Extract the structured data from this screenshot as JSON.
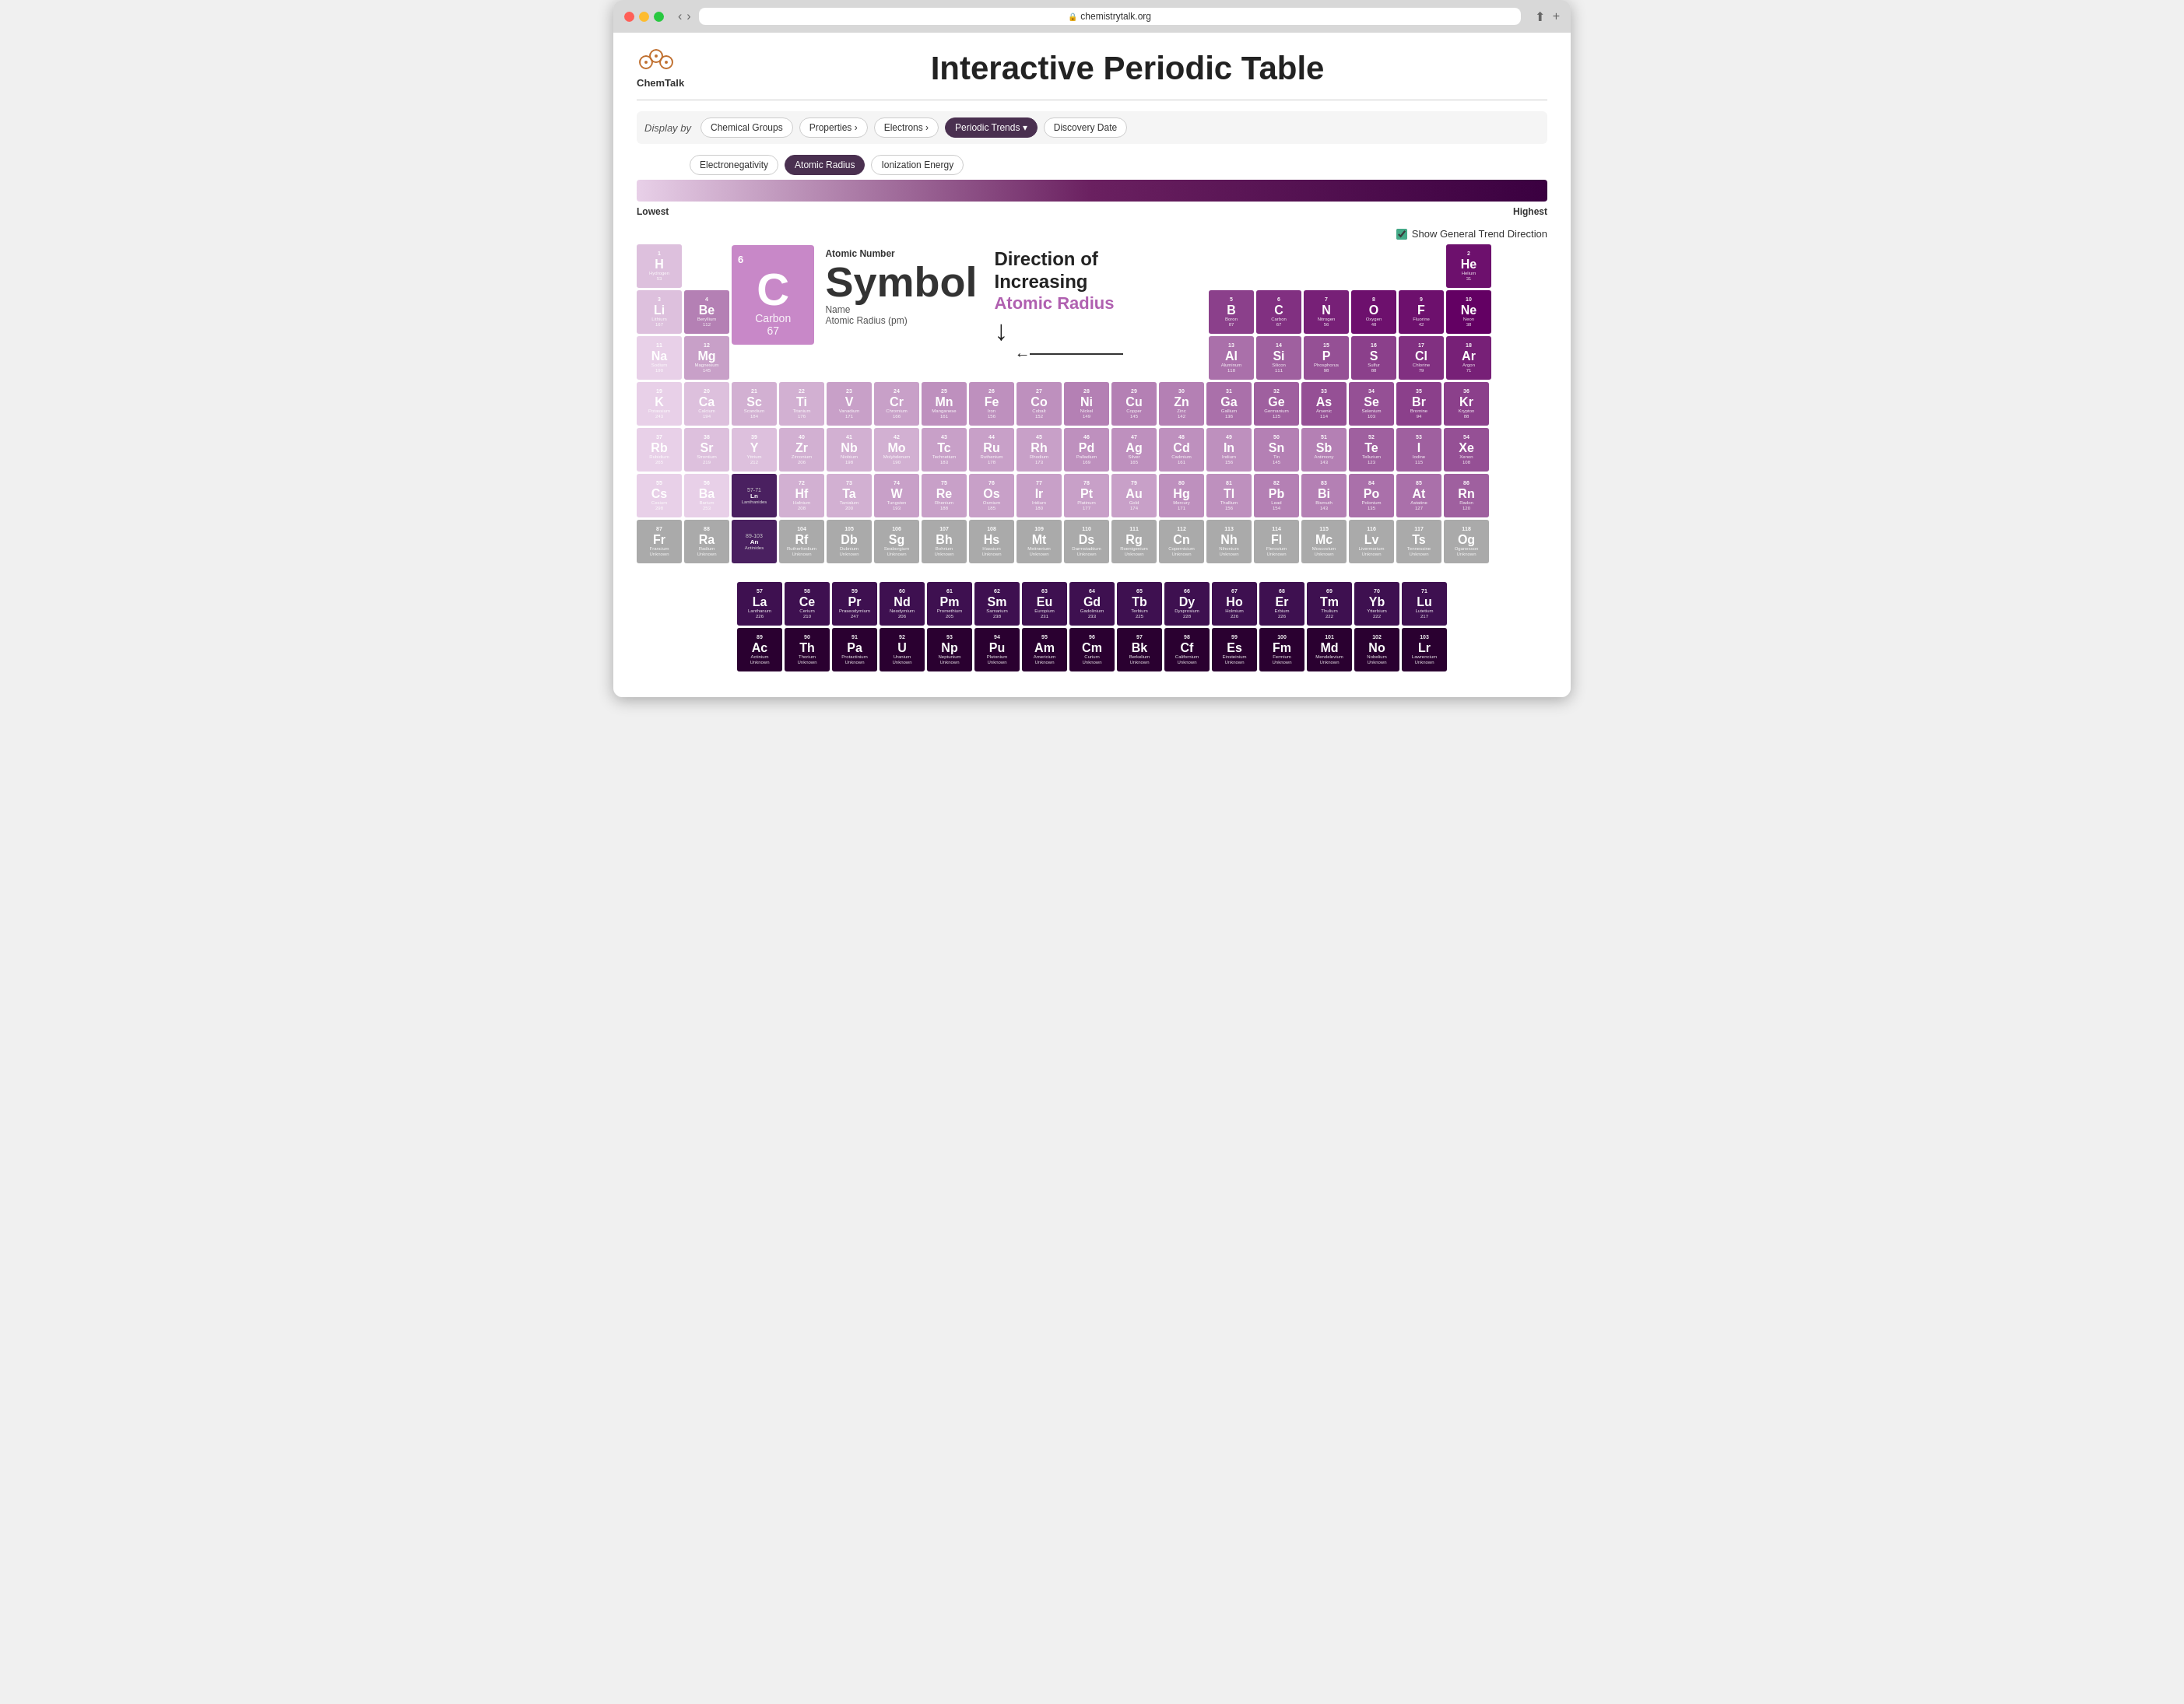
{
  "browser": {
    "url": "chemistrytalk.org"
  },
  "header": {
    "logo": "ChemTalk",
    "title": "Interactive Periodic Table"
  },
  "toolbar": {
    "display_label": "Display by",
    "buttons": [
      {
        "id": "chemical-groups",
        "label": "Chemical Groups",
        "active": false
      },
      {
        "id": "properties",
        "label": "Properties",
        "arrow": true,
        "active": false
      },
      {
        "id": "electrons",
        "label": "Electrons",
        "arrow": true,
        "active": false
      },
      {
        "id": "periodic-trends",
        "label": "Periodic Trends",
        "arrow": true,
        "active": true
      },
      {
        "id": "discovery-date",
        "label": "Discovery Date",
        "active": false
      }
    ],
    "sub_buttons": [
      {
        "id": "electronegativity",
        "label": "Electronegativity",
        "active": false
      },
      {
        "id": "atomic-radius",
        "label": "Atomic Radius",
        "active": true
      },
      {
        "id": "ionization-energy",
        "label": "Ionization Energy",
        "active": false
      }
    ]
  },
  "gradient": {
    "lowest": "Lowest",
    "highest": "Highest"
  },
  "show_trend": {
    "label": "Show General Trend Direction",
    "checked": true
  },
  "featured_element": {
    "number": "6",
    "symbol": "C",
    "name": "Carbon",
    "mass": "67",
    "info_label_atomic_number": "Atomic Number",
    "info_symbol": "Symbol",
    "info_label_name": "Name",
    "info_label_mass": "Atomic Radius (pm)"
  },
  "direction": {
    "title": "Direction of Increasing",
    "subtitle": "Atomic Radius"
  },
  "elements": {
    "row1": [
      {
        "num": "1",
        "sym": "H",
        "name": "Hydrogen",
        "mass": "53",
        "col": "c1"
      },
      {
        "num": "2",
        "sym": "He",
        "name": "Helium",
        "mass": "31",
        "col": "cc"
      }
    ],
    "row2": [
      {
        "num": "3",
        "sym": "Li",
        "name": "Lithium",
        "mass": "167",
        "col": "c1"
      },
      {
        "num": "4",
        "sym": "Be",
        "name": "Beryllium",
        "mass": "112",
        "col": "c5"
      },
      {
        "num": "5",
        "sym": "B",
        "name": "Boron",
        "mass": "87",
        "col": "c9"
      },
      {
        "num": "6",
        "sym": "C",
        "name": "Carbon",
        "mass": "67",
        "col": "ca"
      },
      {
        "num": "7",
        "sym": "N",
        "name": "Nitrogen",
        "mass": "56",
        "col": "cb"
      },
      {
        "num": "8",
        "sym": "O",
        "name": "Oxygen",
        "mass": "48",
        "col": "cc"
      },
      {
        "num": "9",
        "sym": "F",
        "name": "Fluorine",
        "mass": "42",
        "col": "cc"
      },
      {
        "num": "10",
        "sym": "Ne",
        "name": "Neon",
        "mass": "38",
        "col": "cd"
      }
    ],
    "row3": [
      {
        "num": "11",
        "sym": "Na",
        "name": "Sodium",
        "mass": "190",
        "col": "c0"
      },
      {
        "num": "12",
        "sym": "Mg",
        "name": "Magnesium",
        "mass": "145",
        "col": "c3"
      },
      {
        "num": "13",
        "sym": "Al",
        "name": "Aluminum",
        "mass": "118",
        "col": "c6"
      },
      {
        "num": "14",
        "sym": "Si",
        "name": "Silicon",
        "mass": "111",
        "col": "c7"
      },
      {
        "num": "15",
        "sym": "P",
        "name": "Phosphorus",
        "mass": "98",
        "col": "c8"
      },
      {
        "num": "16",
        "sym": "S",
        "name": "Sulfur",
        "mass": "88",
        "col": "c9"
      },
      {
        "num": "17",
        "sym": "Cl",
        "name": "Chlorine",
        "mass": "79",
        "col": "ca"
      },
      {
        "num": "18",
        "sym": "Ar",
        "name": "Argon",
        "mass": "71",
        "col": "cb"
      }
    ],
    "row4": [
      {
        "num": "19",
        "sym": "K",
        "name": "Potassium",
        "mass": "243",
        "col": "c0"
      },
      {
        "num": "20",
        "sym": "Ca",
        "name": "Calcium",
        "mass": "194",
        "col": "c1"
      },
      {
        "num": "21",
        "sym": "Sc",
        "name": "Scandium",
        "mass": "184",
        "col": "c2"
      },
      {
        "num": "22",
        "sym": "Ti",
        "name": "Titanium",
        "mass": "176",
        "col": "c2"
      },
      {
        "num": "23",
        "sym": "V",
        "name": "Vanadium",
        "mass": "171",
        "col": "c3"
      },
      {
        "num": "24",
        "sym": "Cr",
        "name": "Chromium",
        "mass": "166",
        "col": "c3"
      },
      {
        "num": "25",
        "sym": "Mn",
        "name": "Manganese",
        "mass": "161",
        "col": "c4"
      },
      {
        "num": "26",
        "sym": "Fe",
        "name": "Iron",
        "mass": "156",
        "col": "c4"
      },
      {
        "num": "27",
        "sym": "Co",
        "name": "Cobalt",
        "mass": "152",
        "col": "c4"
      },
      {
        "num": "28",
        "sym": "Ni",
        "name": "Nickel",
        "mass": "149",
        "col": "c5"
      },
      {
        "num": "29",
        "sym": "Cu",
        "name": "Copper",
        "mass": "145",
        "col": "c5"
      },
      {
        "num": "30",
        "sym": "Zn",
        "name": "Zinc",
        "mass": "142",
        "col": "c5"
      },
      {
        "num": "31",
        "sym": "Ga",
        "name": "Gallium",
        "mass": "136",
        "col": "c6"
      },
      {
        "num": "32",
        "sym": "Ge",
        "name": "Germanium",
        "mass": "125",
        "col": "c7"
      },
      {
        "num": "33",
        "sym": "As",
        "name": "Arsenic",
        "mass": "114",
        "col": "c8"
      },
      {
        "num": "34",
        "sym": "Se",
        "name": "Selenium",
        "mass": "103",
        "col": "c8"
      },
      {
        "num": "35",
        "sym": "Br",
        "name": "Bromine",
        "mass": "94",
        "col": "c9"
      },
      {
        "num": "36",
        "sym": "Kr",
        "name": "Krypton",
        "mass": "88",
        "col": "c9"
      }
    ],
    "row5": [
      {
        "num": "37",
        "sym": "Rb",
        "name": "Rubidium",
        "mass": "265",
        "col": "c0"
      },
      {
        "num": "38",
        "sym": "Sr",
        "name": "Strontium",
        "mass": "219",
        "col": "c1"
      },
      {
        "num": "39",
        "sym": "Y",
        "name": "Yttrium",
        "mass": "212",
        "col": "c1"
      },
      {
        "num": "40",
        "sym": "Zr",
        "name": "Zirconium",
        "mass": "206",
        "col": "c2"
      },
      {
        "num": "41",
        "sym": "Nb",
        "name": "Niobium",
        "mass": "198",
        "col": "c2"
      },
      {
        "num": "42",
        "sym": "Mo",
        "name": "Molybdenum",
        "mass": "190",
        "col": "c2"
      },
      {
        "num": "43",
        "sym": "Tc",
        "name": "Technetium",
        "mass": "183",
        "col": "c3"
      },
      {
        "num": "44",
        "sym": "Ru",
        "name": "Ruthenium",
        "mass": "178",
        "col": "c3"
      },
      {
        "num": "45",
        "sym": "Rh",
        "name": "Rhodium",
        "mass": "173",
        "col": "c3"
      },
      {
        "num": "46",
        "sym": "Pd",
        "name": "Palladium",
        "mass": "169",
        "col": "c4"
      },
      {
        "num": "47",
        "sym": "Ag",
        "name": "Silver",
        "mass": "165",
        "col": "c4"
      },
      {
        "num": "48",
        "sym": "Cd",
        "name": "Cadmium",
        "mass": "161",
        "col": "c4"
      },
      {
        "num": "49",
        "sym": "In",
        "name": "Indium",
        "mass": "156",
        "col": "c4"
      },
      {
        "num": "50",
        "sym": "Sn",
        "name": "Tin",
        "mass": "145",
        "col": "c5"
      },
      {
        "num": "51",
        "sym": "Sb",
        "name": "Antimony",
        "mass": "143",
        "col": "c5"
      },
      {
        "num": "52",
        "sym": "Te",
        "name": "Tellurium",
        "mass": "123",
        "col": "c7"
      },
      {
        "num": "53",
        "sym": "I",
        "name": "Iodine",
        "mass": "115",
        "col": "c7"
      },
      {
        "num": "54",
        "sym": "Xe",
        "name": "Xenon",
        "mass": "108",
        "col": "c8"
      }
    ],
    "row6": [
      {
        "num": "55",
        "sym": "Cs",
        "name": "Cesium",
        "mass": "298",
        "col": "c0"
      },
      {
        "num": "56",
        "sym": "Ba",
        "name": "Barium",
        "mass": "253",
        "col": "c0"
      },
      {
        "num": "57-71",
        "sym": "",
        "name": "Lanthanides",
        "mass": "57-71",
        "col": "cl",
        "span": true
      },
      {
        "num": "72",
        "sym": "Hf",
        "name": "Hafnium",
        "mass": "208",
        "col": "c2"
      },
      {
        "num": "73",
        "sym": "Ta",
        "name": "Tantalum",
        "mass": "200",
        "col": "c2"
      },
      {
        "num": "74",
        "sym": "W",
        "name": "Tungsten",
        "mass": "193",
        "col": "c3"
      },
      {
        "num": "75",
        "sym": "Re",
        "name": "Rhenium",
        "mass": "188",
        "col": "c3"
      },
      {
        "num": "76",
        "sym": "Os",
        "name": "Osmium",
        "mass": "185",
        "col": "c3"
      },
      {
        "num": "77",
        "sym": "Ir",
        "name": "Iridium",
        "mass": "180",
        "col": "c3"
      },
      {
        "num": "78",
        "sym": "Pt",
        "name": "Platinum",
        "mass": "177",
        "col": "c3"
      },
      {
        "num": "79",
        "sym": "Au",
        "name": "Gold",
        "mass": "174",
        "col": "c3"
      },
      {
        "num": "80",
        "sym": "Hg",
        "name": "Mercury",
        "mass": "171",
        "col": "c4"
      },
      {
        "num": "81",
        "sym": "Tl",
        "name": "Thallium",
        "mass": "156",
        "col": "c4"
      },
      {
        "num": "82",
        "sym": "Pb",
        "name": "Lead",
        "mass": "154",
        "col": "c5"
      },
      {
        "num": "83",
        "sym": "Bi",
        "name": "Bismuth",
        "mass": "143",
        "col": "c5"
      },
      {
        "num": "84",
        "sym": "Po",
        "name": "Polonium",
        "mass": "135",
        "col": "c6"
      },
      {
        "num": "85",
        "sym": "At",
        "name": "Astatine",
        "mass": "127",
        "col": "c6"
      },
      {
        "num": "86",
        "sym": "Rn",
        "name": "Radon",
        "mass": "120",
        "col": "c7"
      }
    ],
    "row7": [
      {
        "num": "87",
        "sym": "Fr",
        "name": "Francium",
        "mass": "Unknown",
        "col": "cg"
      },
      {
        "num": "88",
        "sym": "Ra",
        "name": "Radium",
        "mass": "Unknown",
        "col": "cg"
      },
      {
        "num": "89-103",
        "sym": "",
        "name": "Actinides",
        "mass": "89-103",
        "col": "cl",
        "span": true
      },
      {
        "num": "104",
        "sym": "Rf",
        "name": "Rutherfordium",
        "mass": "Unknown",
        "col": "cg"
      },
      {
        "num": "105",
        "sym": "Db",
        "name": "Dubnium",
        "mass": "Unknown",
        "col": "cg"
      },
      {
        "num": "106",
        "sym": "Sg",
        "name": "Seaborgium",
        "mass": "Unknown",
        "col": "cg"
      },
      {
        "num": "107",
        "sym": "Bh",
        "name": "Bohrium",
        "mass": "Unknown",
        "col": "cg"
      },
      {
        "num": "108",
        "sym": "Hs",
        "name": "Hassium",
        "mass": "Unknown",
        "col": "cg"
      },
      {
        "num": "109",
        "sym": "Mt",
        "name": "Meitnerium",
        "mass": "Unknown",
        "col": "cg"
      },
      {
        "num": "110",
        "sym": "Ds",
        "name": "Darmstadtium",
        "mass": "Unknown",
        "col": "cg"
      },
      {
        "num": "111",
        "sym": "Rg",
        "name": "Roentgenium",
        "mass": "Unknown",
        "col": "cg"
      },
      {
        "num": "112",
        "sym": "Cn",
        "name": "Copernicium",
        "mass": "Unknown",
        "col": "cg"
      },
      {
        "num": "113",
        "sym": "Nh",
        "name": "Nihonium",
        "mass": "Unknown",
        "col": "cg"
      },
      {
        "num": "114",
        "sym": "Fl",
        "name": "Flerovium",
        "mass": "Unknown",
        "col": "cg"
      },
      {
        "num": "115",
        "sym": "Mc",
        "name": "Moscovium",
        "mass": "Unknown",
        "col": "cg"
      },
      {
        "num": "116",
        "sym": "Lv",
        "name": "Livermorium",
        "mass": "Unknown",
        "col": "cg"
      },
      {
        "num": "117",
        "sym": "Ts",
        "name": "Tennessine",
        "mass": "Unknown",
        "col": "cg"
      },
      {
        "num": "118",
        "sym": "Og",
        "name": "Oganesson",
        "mass": "Unknown",
        "col": "cg"
      }
    ],
    "lanthanides": [
      {
        "num": "57",
        "sym": "La",
        "name": "Lanthanum",
        "mass": "226",
        "col": "cl"
      },
      {
        "num": "58",
        "sym": "Ce",
        "name": "Cerium",
        "mass": "210",
        "col": "cl"
      },
      {
        "num": "59",
        "sym": "Pr",
        "name": "Praseodymium",
        "mass": "247",
        "col": "cl"
      },
      {
        "num": "60",
        "sym": "Nd",
        "name": "Neodymium",
        "mass": "206",
        "col": "cl"
      },
      {
        "num": "61",
        "sym": "Pm",
        "name": "Promethium",
        "mass": "205",
        "col": "cl"
      },
      {
        "num": "62",
        "sym": "Sm",
        "name": "Samarium",
        "mass": "238",
        "col": "cl"
      },
      {
        "num": "63",
        "sym": "Eu",
        "name": "Europium",
        "mass": "231",
        "col": "cl"
      },
      {
        "num": "64",
        "sym": "Gd",
        "name": "Gadolinium",
        "mass": "233",
        "col": "cl"
      },
      {
        "num": "65",
        "sym": "Tb",
        "name": "Terbium",
        "mass": "225",
        "col": "cl"
      },
      {
        "num": "66",
        "sym": "Dy",
        "name": "Dysprosium",
        "mass": "228",
        "col": "cl"
      },
      {
        "num": "67",
        "sym": "Ho",
        "name": "Holmium",
        "mass": "226",
        "col": "cl"
      },
      {
        "num": "68",
        "sym": "Er",
        "name": "Erbium",
        "mass": "226",
        "col": "cl"
      },
      {
        "num": "69",
        "sym": "Tm",
        "name": "Thulium",
        "mass": "222",
        "col": "cl"
      },
      {
        "num": "70",
        "sym": "Yb",
        "name": "Ytterbium",
        "mass": "222",
        "col": "cl"
      },
      {
        "num": "71",
        "sym": "Lu",
        "name": "Lutetium",
        "mass": "217",
        "col": "cl"
      }
    ],
    "actinides": [
      {
        "num": "89",
        "sym": "Ac",
        "name": "Actinium",
        "mass": "Unknown",
        "col": "ac"
      },
      {
        "num": "90",
        "sym": "Th",
        "name": "Thorium",
        "mass": "Unknown",
        "col": "ac"
      },
      {
        "num": "91",
        "sym": "Pa",
        "name": "Protactinium",
        "mass": "Unknown",
        "col": "ac"
      },
      {
        "num": "92",
        "sym": "U",
        "name": "Uranium",
        "mass": "Unknown",
        "col": "ac"
      },
      {
        "num": "93",
        "sym": "Np",
        "name": "Neptunium",
        "mass": "Unknown",
        "col": "ac"
      },
      {
        "num": "94",
        "sym": "Pu",
        "name": "Plutonium",
        "mass": "Unknown",
        "col": "ac"
      },
      {
        "num": "95",
        "sym": "Am",
        "name": "Americium",
        "mass": "Unknown",
        "col": "ac"
      },
      {
        "num": "96",
        "sym": "Cm",
        "name": "Curium",
        "mass": "Unknown",
        "col": "ac"
      },
      {
        "num": "97",
        "sym": "Bk",
        "name": "Berkelium",
        "mass": "Unknown",
        "col": "ac"
      },
      {
        "num": "98",
        "sym": "Cf",
        "name": "Californium",
        "mass": "Unknown",
        "col": "ac"
      },
      {
        "num": "99",
        "sym": "Es",
        "name": "Einsteinium",
        "mass": "Unknown",
        "col": "ac"
      },
      {
        "num": "100",
        "sym": "Fm",
        "name": "Fermium",
        "mass": "Unknown",
        "col": "ac"
      },
      {
        "num": "101",
        "sym": "Md",
        "name": "Mendelevium",
        "mass": "Unknown",
        "col": "ac"
      },
      {
        "num": "102",
        "sym": "No",
        "name": "Nobelium",
        "mass": "Unknown",
        "col": "ac"
      },
      {
        "num": "103",
        "sym": "Lr",
        "name": "Lawrencium",
        "mass": "Unknown",
        "col": "ac"
      }
    ]
  }
}
